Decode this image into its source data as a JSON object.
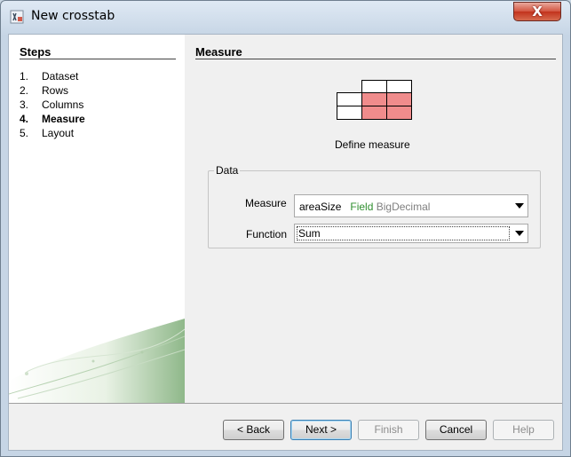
{
  "window": {
    "title": "New crosstab",
    "close_label": "X"
  },
  "sidebar": {
    "title": "Steps",
    "steps": [
      {
        "num": "1.",
        "label": "Dataset"
      },
      {
        "num": "2.",
        "label": "Rows"
      },
      {
        "num": "3.",
        "label": "Columns"
      },
      {
        "num": "4.",
        "label": "Measure"
      },
      {
        "num": "5.",
        "label": "Layout"
      }
    ],
    "active_step": 3
  },
  "main": {
    "title": "Measure",
    "subtitle": "Define measure",
    "group_label": "Data",
    "measure": {
      "label": "Measure",
      "field_name": "areaSize",
      "field_type": "Field",
      "field_class": "BigDecimal"
    },
    "function": {
      "label": "Function",
      "value": "Sum"
    }
  },
  "buttons": {
    "back": "< Back",
    "next": "Next >",
    "finish": "Finish",
    "cancel": "Cancel",
    "help": "Help"
  },
  "colors": {
    "measure_cells": "#f08c8c",
    "field_type": "#2f8f2f",
    "field_class": "#808080"
  }
}
